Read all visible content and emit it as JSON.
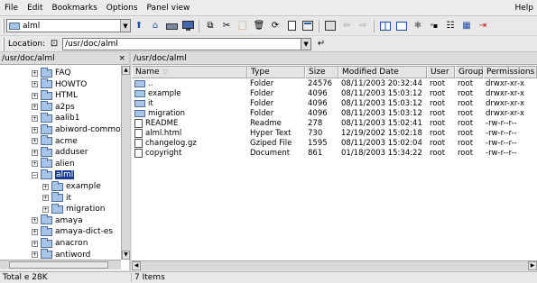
{
  "menu": {
    "items": [
      "File",
      "Edit",
      "Bookmarks",
      "Options",
      "Panel view"
    ],
    "help": "Help"
  },
  "toolbar": {
    "path_value": "alml"
  },
  "location": {
    "label": "Location:",
    "value": "/usr/doc/alml"
  },
  "left_panel": {
    "title": "/usr/doc/alml",
    "close": "×",
    "tree": [
      {
        "label": "FAQ",
        "level": 1,
        "expander": "+"
      },
      {
        "label": "HOWTO",
        "level": 1,
        "expander": "+"
      },
      {
        "label": "HTML",
        "level": 1,
        "expander": "+"
      },
      {
        "label": "a2ps",
        "level": 1,
        "expander": "+"
      },
      {
        "label": "aalib1",
        "level": 1,
        "expander": "+"
      },
      {
        "label": "abiword-common",
        "level": 1,
        "expander": "+"
      },
      {
        "label": "acme",
        "level": 1,
        "expander": "+"
      },
      {
        "label": "adduser",
        "level": 1,
        "expander": "+"
      },
      {
        "label": "alien",
        "level": 1,
        "expander": "+"
      },
      {
        "label": "alml",
        "level": 1,
        "expander": "−",
        "selected": true
      },
      {
        "label": "example",
        "level": 2,
        "expander": "+"
      },
      {
        "label": "it",
        "level": 2,
        "expander": "+"
      },
      {
        "label": "migration",
        "level": 2,
        "expander": "+"
      },
      {
        "label": "amaya",
        "level": 1,
        "expander": "+"
      },
      {
        "label": "amaya-dict-es",
        "level": 1,
        "expander": "+"
      },
      {
        "label": "anacron",
        "level": 1,
        "expander": "+"
      },
      {
        "label": "antiword",
        "level": 1,
        "expander": "+"
      }
    ]
  },
  "right_panel": {
    "title": "/usr/doc/alml",
    "columns": [
      "Name",
      "Type",
      "Size",
      "Modified Date",
      "User",
      "Group",
      "Permissions"
    ],
    "files": [
      {
        "name": "..",
        "icon": "folder",
        "type": "Folder",
        "size": "24576",
        "date": "08/11/2003 20:32:44",
        "user": "root",
        "group": "root",
        "perm": "drwxr-xr-x"
      },
      {
        "name": "example",
        "icon": "folder",
        "type": "Folder",
        "size": "4096",
        "date": "08/11/2003 15:03:12",
        "user": "root",
        "group": "root",
        "perm": "drwxr-xr-x"
      },
      {
        "name": "it",
        "icon": "folder",
        "type": "Folder",
        "size": "4096",
        "date": "08/11/2003 15:03:12",
        "user": "root",
        "group": "root",
        "perm": "drwxr-xr-x"
      },
      {
        "name": "migration",
        "icon": "folder",
        "type": "Folder",
        "size": "4096",
        "date": "08/11/2003 15:03:12",
        "user": "root",
        "group": "root",
        "perm": "drwxr-xr-x"
      },
      {
        "name": "README",
        "icon": "file",
        "type": "Readme",
        "size": "278",
        "date": "08/11/2003 15:02:41",
        "user": "root",
        "group": "root",
        "perm": "-rw-r--r--"
      },
      {
        "name": "alml.html",
        "icon": "file",
        "type": "Hyper Text",
        "size": "730",
        "date": "12/19/2002 15:02:18",
        "user": "root",
        "group": "root",
        "perm": "-rw-r--r--"
      },
      {
        "name": "changelog.gz",
        "icon": "file",
        "type": "Gziped File",
        "size": "1595",
        "date": "08/11/2003 15:02:04",
        "user": "root",
        "group": "root",
        "perm": "-rw-r--r--"
      },
      {
        "name": "copyright",
        "icon": "file",
        "type": "Document",
        "size": "861",
        "date": "01/18/2003 15:34:22",
        "user": "root",
        "group": "root",
        "perm": "-rw-r--r--"
      }
    ]
  },
  "status": {
    "left": "Total e 28K",
    "right": "7 Items"
  }
}
